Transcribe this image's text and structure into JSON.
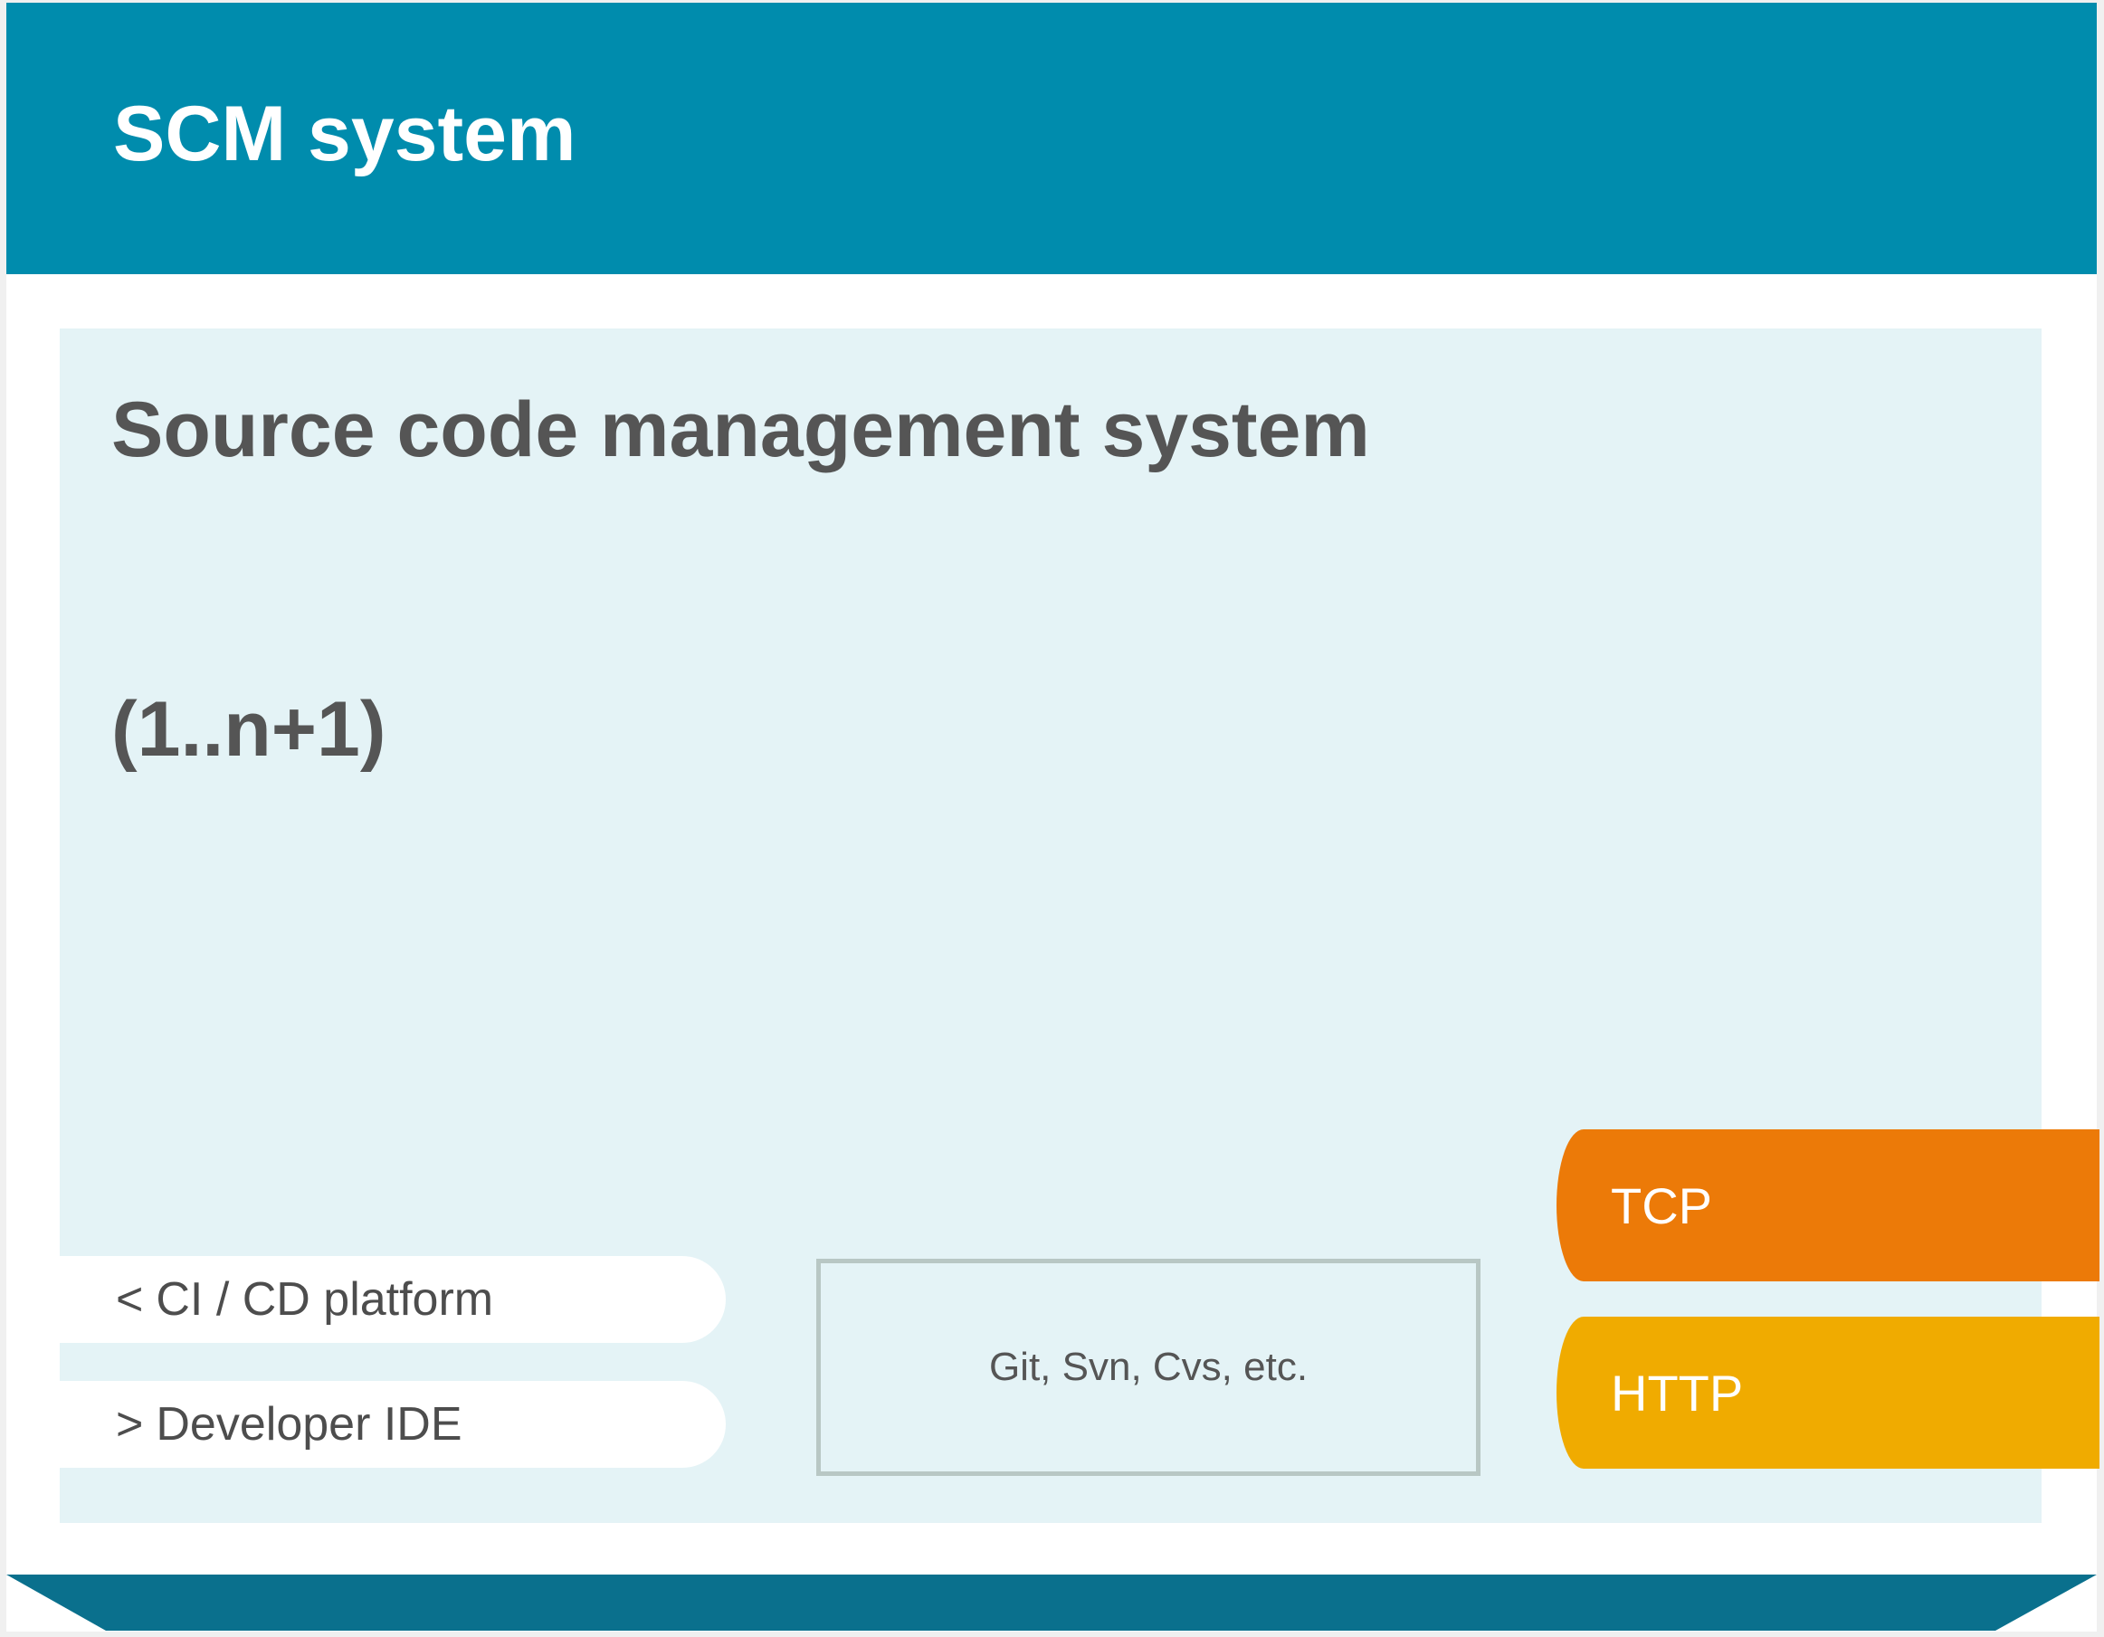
{
  "header": {
    "title": "SCM system"
  },
  "panel": {
    "title": "Source code management system",
    "multiplicity": "(1..n+1)"
  },
  "connections": [
    {
      "arrow": "<",
      "label": "CI / CD platform"
    },
    {
      "arrow": ">",
      "label": "Developer IDE"
    }
  ],
  "technologies": {
    "label": "Git, Svn, Cvs, etc."
  },
  "protocols": [
    {
      "label": "TCP",
      "color": "#ec7a08"
    },
    {
      "label": "HTTP",
      "color": "#f0ab00"
    }
  ],
  "colors": {
    "header": "#008cad",
    "panel": "#e4f3f6",
    "footer": "#0a708d",
    "text": "#555555"
  }
}
